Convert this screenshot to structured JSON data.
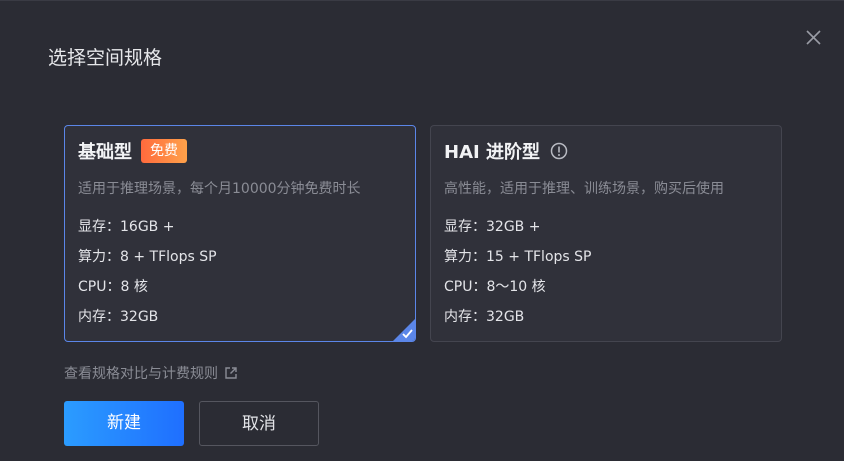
{
  "dialog": {
    "title": "选择空间规格",
    "close_icon": "close-icon"
  },
  "cards": {
    "basic": {
      "title": "基础型",
      "badge": "免费",
      "description": "适用于推理场景，每个月10000分钟免费时长",
      "specs": [
        "显存：16GB +",
        "算力：8 + TFlops SP",
        "CPU：8 核",
        "内存：32GB"
      ],
      "selected": true
    },
    "hai": {
      "title": "HAI 进阶型",
      "info_icon": "info-icon",
      "description": "高性能，适用于推理、训练场景，购买后使用",
      "specs": [
        "显存：32GB +",
        "算力：15 + TFlops SP",
        "CPU：8～10 核",
        "内存：32GB"
      ],
      "selected": false
    }
  },
  "compare_link": {
    "label": "查看规格对比与计费规则",
    "icon": "external-link-icon"
  },
  "buttons": {
    "create": "新建",
    "cancel": "取消"
  },
  "colors": {
    "background": "#2b2c34",
    "card": "#30313a",
    "selected_border": "#5b86e8",
    "badge_start": "#ff6a3d",
    "badge_end": "#ffa24a",
    "primary_start": "#2b9cff",
    "primary_end": "#1f6fff"
  }
}
